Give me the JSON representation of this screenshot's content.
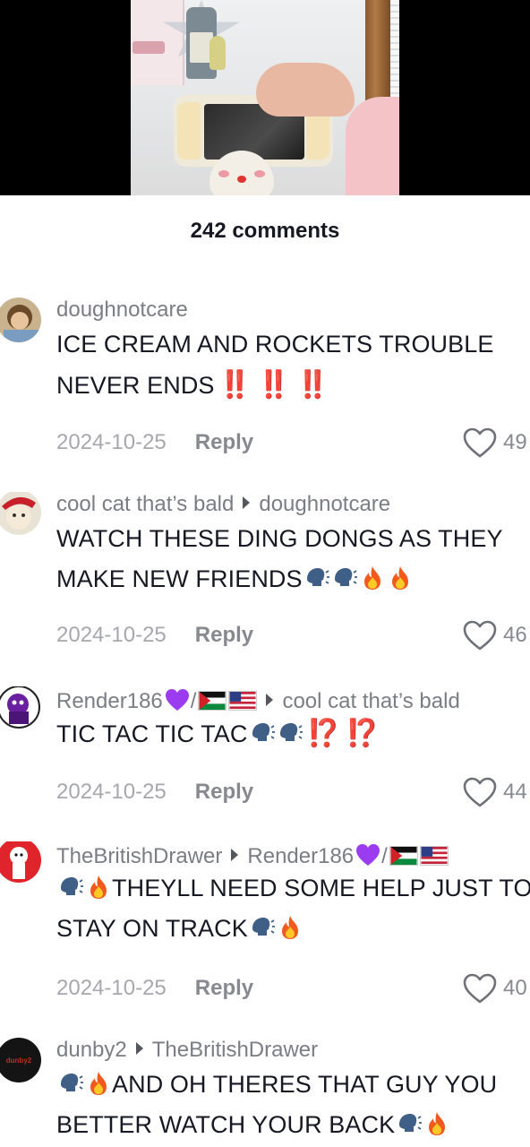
{
  "video": {
    "icon": "video-thumbnail"
  },
  "comments_header": {
    "count_label": "242 comments"
  },
  "comments": [
    {
      "username": "doughnotcare",
      "reply_to": "",
      "line1": "ICE CREAM AND ROCKETS TROUBLE",
      "line2": "NEVER ENDS",
      "line2_suffix": "‼️ ‼️ ‼️",
      "date": "2024-10-25",
      "reply_label": "Reply",
      "likes": "49"
    },
    {
      "username": "cool cat that’s bald",
      "reply_to": "doughnotcare",
      "line1": "WATCH THESE DING DONGS AS THEY",
      "line2": "MAKE NEW FRIENDS",
      "date": "2024-10-25",
      "reply_label": "Reply",
      "likes": "46"
    },
    {
      "username": "Render186",
      "username_suffix": "/",
      "reply_to": "cool cat that’s bald",
      "line1": "TIC TAC TIC TAC",
      "line1_suffix": "⁉️ ⁉️",
      "date": "2024-10-25",
      "reply_label": "Reply",
      "likes": "44"
    },
    {
      "username": "TheBritishDrawer",
      "reply_to": "Render186",
      "reply_to_suffix": "/",
      "line1": "THEYLL NEED SOME HELP JUST TO",
      "line2": "STAY ON TRACK",
      "date": "2024-10-25",
      "reply_label": "Reply",
      "likes": "40"
    },
    {
      "username": "dunby2",
      "reply_to": "TheBritishDrawer",
      "line1": "AND OH THERES THAT GUY YOU",
      "line2": "BETTER WATCH YOUR BACK"
    }
  ],
  "avatar_badges": {
    "dunby2": "dunby2"
  },
  "colors": {
    "text": "#161823",
    "secondary": "#7b7d85",
    "meta": "#a6a8ae",
    "accent_red": "#e2261d",
    "purple_heart": "#9b3cf0"
  }
}
